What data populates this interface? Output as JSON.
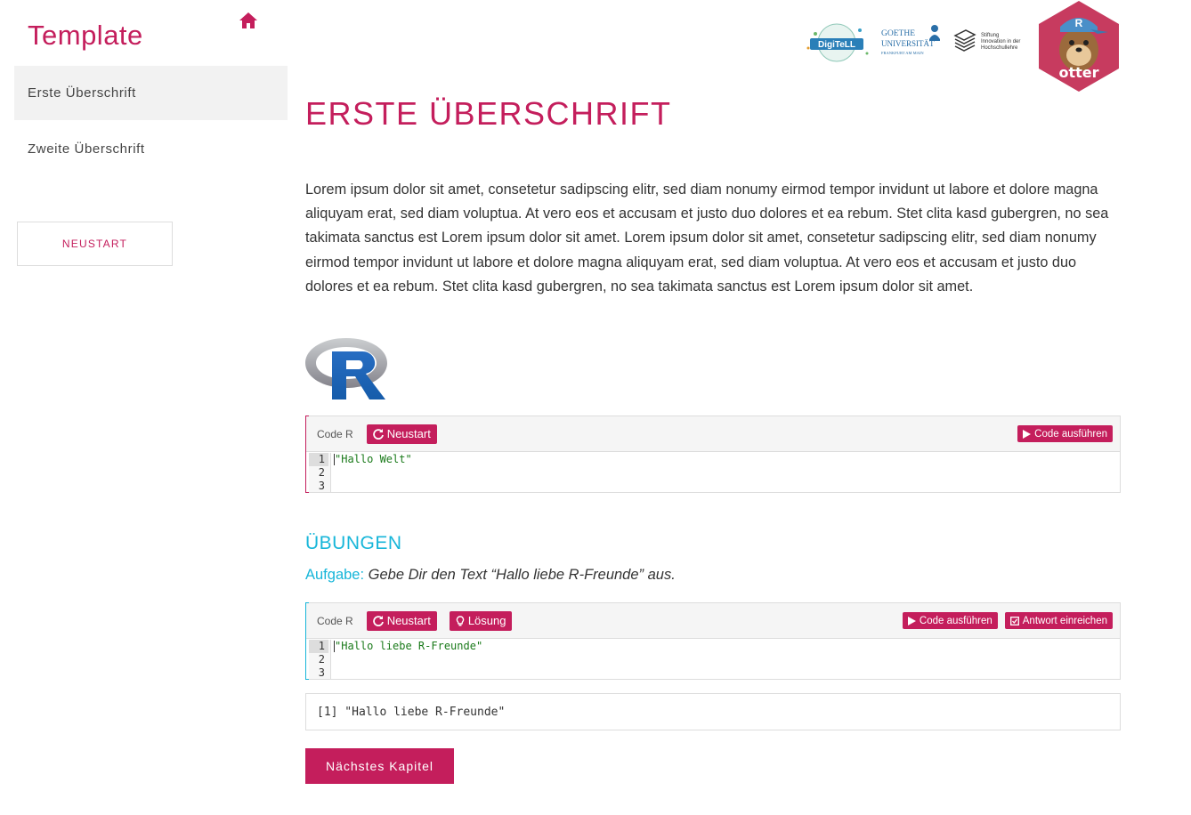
{
  "sidebar": {
    "title": "Template",
    "items": [
      {
        "label": "Erste Überschrift"
      },
      {
        "label": "Zweite Überschrift"
      }
    ],
    "restart_label": "NEUSTART"
  },
  "logos": {
    "digitell_text": "DigiTeLL",
    "goethe_line1": "GOETHE",
    "goethe_line2": "UNIVERSITÄT",
    "goethe_line3": "FRANKFURT AM MAIN",
    "stiftung_line1": "Stiftung",
    "stiftung_line2": "Innovation in der",
    "stiftung_line3": "Hochschullehre",
    "otter_text": "otter"
  },
  "main": {
    "title": "ERSTE ÜBERSCHRIFT",
    "paragraph": "Lorem ipsum dolor sit amet, consetetur sadipscing elitr, sed diam nonumy eirmod tempor invidunt ut labore et dolore magna aliquyam erat, sed diam voluptua. At vero eos et accusam et justo duo dolores et ea rebum. Stet clita kasd gubergren, no sea takimata sanctus est Lorem ipsum dolor sit amet. Lorem ipsum dolor sit amet, consetetur sadipscing elitr, sed diam nonumy eirmod tempor invidunt ut labore et dolore magna aliquyam erat, sed diam voluptua. At vero eos et accusam et justo duo dolores et ea rebum. Stet clita kasd gubergren, no sea takimata sanctus est Lorem ipsum dolor sit amet.",
    "r_logo_letter": "R"
  },
  "exercise1": {
    "label": "Code R",
    "restart": "Neustart",
    "run": "Code ausführen",
    "lines": [
      "1",
      "2",
      "3"
    ],
    "code": "\"Hallo Welt\""
  },
  "exercises_section": {
    "title": "ÜBUNGEN",
    "task_label": "Aufgabe:",
    "task_text": "Gebe Dir den Text “Hallo liebe R-Freunde” aus."
  },
  "exercise2": {
    "label": "Code R",
    "restart": "Neustart",
    "solution": "Lösung",
    "run": "Code ausführen",
    "submit": "Antwort einreichen",
    "lines": [
      "1",
      "2",
      "3"
    ],
    "code": "\"Hallo liebe R-Freunde\"",
    "output": "[1] \"Hallo liebe R-Freunde\""
  },
  "next_chapter": "Nächstes Kapitel",
  "colors": {
    "accent": "#c41e5c",
    "secondary": "#17b6d9"
  }
}
